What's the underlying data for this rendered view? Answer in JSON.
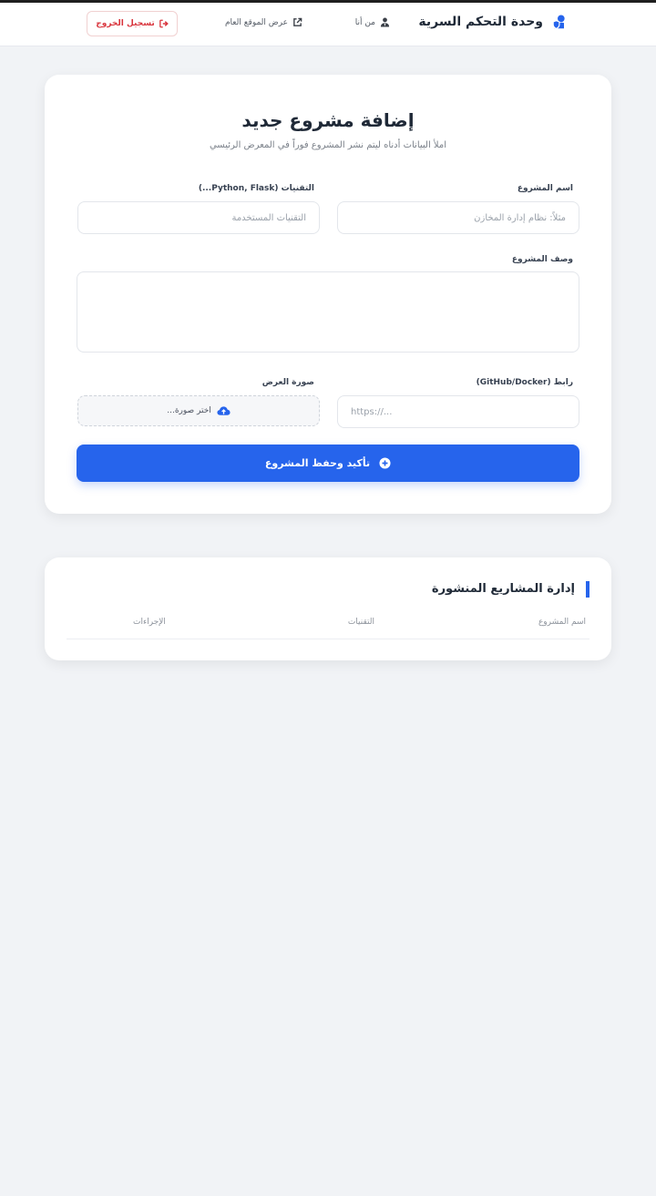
{
  "navbar": {
    "brand": "وحدة التحكم السرية",
    "about_link": "من أنا",
    "public_site_link": "عرض الموقع العام",
    "logout_button": "تسجيل الخروج",
    "brand_color": "#2664ec",
    "logout_color": "#d9363e"
  },
  "form": {
    "title": "إضافة مشروع جديد",
    "subtitle": "املأ البيانات أدناه ليتم نشر المشروع فوراً في المعرض الرئيسي",
    "project_name": {
      "label": "اسم المشروع",
      "placeholder": "مثلاً: نظام إدارة المخازن",
      "value": ""
    },
    "technologies": {
      "label": "التقنيات (Python, Flask...)",
      "placeholder": "التقنيات المستخدمة",
      "value": ""
    },
    "description": {
      "label": "وصف المشروع",
      "value": ""
    },
    "link": {
      "label": "رابط (GitHub/Docker)",
      "placeholder": "https://...",
      "value": ""
    },
    "image": {
      "label": "صورة العرض",
      "button": "اختر صورة..."
    },
    "submit_button": "تأكيد وحفظ المشروع",
    "accent_color": "#2664ec"
  },
  "projects_table": {
    "title": "إدارة المشاريع المنشورة",
    "columns": [
      "اسم المشروع",
      "التقنيات",
      "الإجراءات"
    ],
    "rows": []
  }
}
